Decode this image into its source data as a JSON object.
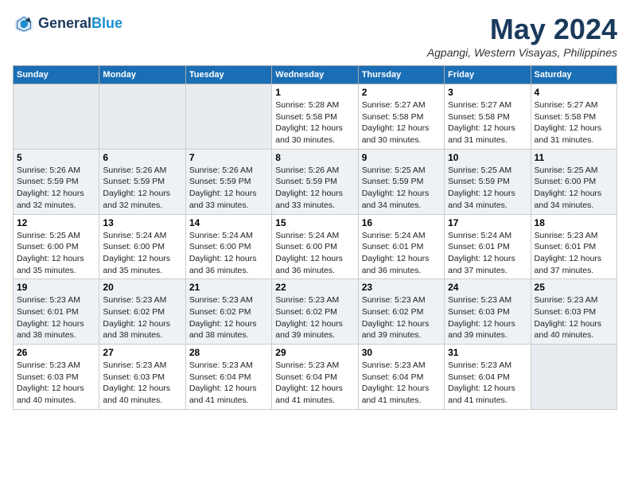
{
  "header": {
    "logo_line1": "General",
    "logo_line2": "Blue",
    "month": "May 2024",
    "location": "Agpangi, Western Visayas, Philippines"
  },
  "weekdays": [
    "Sunday",
    "Monday",
    "Tuesday",
    "Wednesday",
    "Thursday",
    "Friday",
    "Saturday"
  ],
  "rows": [
    {
      "alt": false,
      "cells": [
        {
          "empty": true
        },
        {
          "empty": true
        },
        {
          "empty": true
        },
        {
          "day": 1,
          "sunrise": "5:28 AM",
          "sunset": "5:58 PM",
          "daylight": "12 hours and 30 minutes."
        },
        {
          "day": 2,
          "sunrise": "5:27 AM",
          "sunset": "5:58 PM",
          "daylight": "12 hours and 30 minutes."
        },
        {
          "day": 3,
          "sunrise": "5:27 AM",
          "sunset": "5:58 PM",
          "daylight": "12 hours and 31 minutes."
        },
        {
          "day": 4,
          "sunrise": "5:27 AM",
          "sunset": "5:58 PM",
          "daylight": "12 hours and 31 minutes."
        }
      ]
    },
    {
      "alt": true,
      "cells": [
        {
          "day": 5,
          "sunrise": "5:26 AM",
          "sunset": "5:59 PM",
          "daylight": "12 hours and 32 minutes."
        },
        {
          "day": 6,
          "sunrise": "5:26 AM",
          "sunset": "5:59 PM",
          "daylight": "12 hours and 32 minutes."
        },
        {
          "day": 7,
          "sunrise": "5:26 AM",
          "sunset": "5:59 PM",
          "daylight": "12 hours and 33 minutes."
        },
        {
          "day": 8,
          "sunrise": "5:26 AM",
          "sunset": "5:59 PM",
          "daylight": "12 hours and 33 minutes."
        },
        {
          "day": 9,
          "sunrise": "5:25 AM",
          "sunset": "5:59 PM",
          "daylight": "12 hours and 34 minutes."
        },
        {
          "day": 10,
          "sunrise": "5:25 AM",
          "sunset": "5:59 PM",
          "daylight": "12 hours and 34 minutes."
        },
        {
          "day": 11,
          "sunrise": "5:25 AM",
          "sunset": "6:00 PM",
          "daylight": "12 hours and 34 minutes."
        }
      ]
    },
    {
      "alt": false,
      "cells": [
        {
          "day": 12,
          "sunrise": "5:25 AM",
          "sunset": "6:00 PM",
          "daylight": "12 hours and 35 minutes."
        },
        {
          "day": 13,
          "sunrise": "5:24 AM",
          "sunset": "6:00 PM",
          "daylight": "12 hours and 35 minutes."
        },
        {
          "day": 14,
          "sunrise": "5:24 AM",
          "sunset": "6:00 PM",
          "daylight": "12 hours and 36 minutes."
        },
        {
          "day": 15,
          "sunrise": "5:24 AM",
          "sunset": "6:00 PM",
          "daylight": "12 hours and 36 minutes."
        },
        {
          "day": 16,
          "sunrise": "5:24 AM",
          "sunset": "6:01 PM",
          "daylight": "12 hours and 36 minutes."
        },
        {
          "day": 17,
          "sunrise": "5:24 AM",
          "sunset": "6:01 PM",
          "daylight": "12 hours and 37 minutes."
        },
        {
          "day": 18,
          "sunrise": "5:23 AM",
          "sunset": "6:01 PM",
          "daylight": "12 hours and 37 minutes."
        }
      ]
    },
    {
      "alt": true,
      "cells": [
        {
          "day": 19,
          "sunrise": "5:23 AM",
          "sunset": "6:01 PM",
          "daylight": "12 hours and 38 minutes."
        },
        {
          "day": 20,
          "sunrise": "5:23 AM",
          "sunset": "6:02 PM",
          "daylight": "12 hours and 38 minutes."
        },
        {
          "day": 21,
          "sunrise": "5:23 AM",
          "sunset": "6:02 PM",
          "daylight": "12 hours and 38 minutes."
        },
        {
          "day": 22,
          "sunrise": "5:23 AM",
          "sunset": "6:02 PM",
          "daylight": "12 hours and 39 minutes."
        },
        {
          "day": 23,
          "sunrise": "5:23 AM",
          "sunset": "6:02 PM",
          "daylight": "12 hours and 39 minutes."
        },
        {
          "day": 24,
          "sunrise": "5:23 AM",
          "sunset": "6:03 PM",
          "daylight": "12 hours and 39 minutes."
        },
        {
          "day": 25,
          "sunrise": "5:23 AM",
          "sunset": "6:03 PM",
          "daylight": "12 hours and 40 minutes."
        }
      ]
    },
    {
      "alt": false,
      "cells": [
        {
          "day": 26,
          "sunrise": "5:23 AM",
          "sunset": "6:03 PM",
          "daylight": "12 hours and 40 minutes."
        },
        {
          "day": 27,
          "sunrise": "5:23 AM",
          "sunset": "6:03 PM",
          "daylight": "12 hours and 40 minutes."
        },
        {
          "day": 28,
          "sunrise": "5:23 AM",
          "sunset": "6:04 PM",
          "daylight": "12 hours and 41 minutes."
        },
        {
          "day": 29,
          "sunrise": "5:23 AM",
          "sunset": "6:04 PM",
          "daylight": "12 hours and 41 minutes."
        },
        {
          "day": 30,
          "sunrise": "5:23 AM",
          "sunset": "6:04 PM",
          "daylight": "12 hours and 41 minutes."
        },
        {
          "day": 31,
          "sunrise": "5:23 AM",
          "sunset": "6:04 PM",
          "daylight": "12 hours and 41 minutes."
        },
        {
          "empty": true
        }
      ]
    }
  ]
}
